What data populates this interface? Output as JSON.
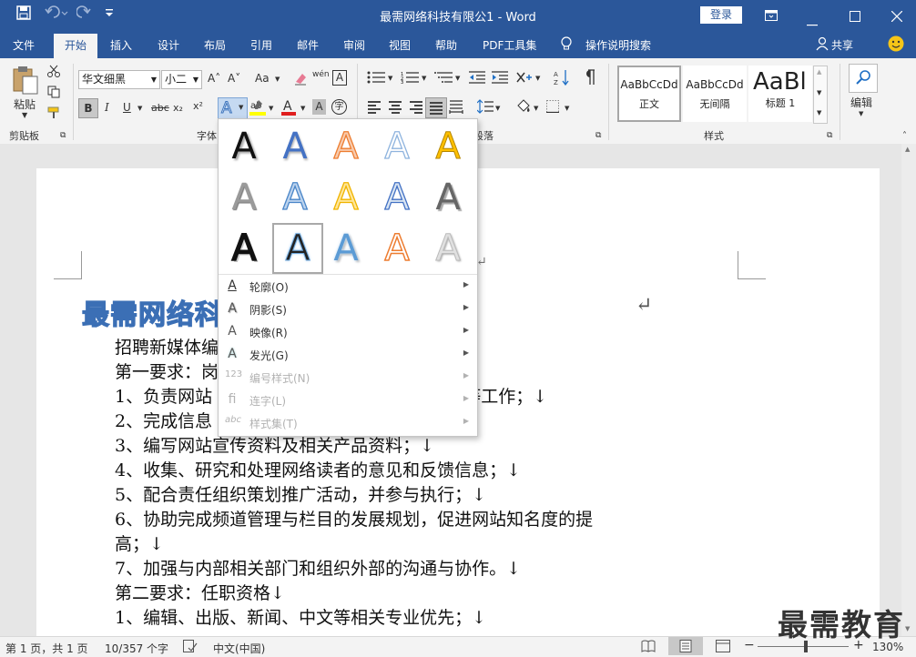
{
  "window": {
    "title": "最需网络科技有限公1 - Word",
    "login": "登录",
    "qat": {
      "save": "save-icon",
      "undo": "undo-icon",
      "redo": "redo-icon",
      "customize": "customize-icon"
    },
    "controls": {
      "ribbon_display": "ribbon-display-icon",
      "minimize": "minimize-icon",
      "maximize": "maximize-icon",
      "close": "close-icon"
    }
  },
  "menu": {
    "tabs": [
      "文件",
      "开始",
      "插入",
      "设计",
      "布局",
      "引用",
      "邮件",
      "审阅",
      "视图",
      "帮助",
      "PDF工具集"
    ],
    "active": "开始",
    "tell_me": "操作说明搜索",
    "share": "共享"
  },
  "ribbon": {
    "clipboard": {
      "paste": "粘贴",
      "label": "剪贴板"
    },
    "font": {
      "name": "华文细黑",
      "size": "小二",
      "label": "字体",
      "bold": "B",
      "italic": "I",
      "underline": "U",
      "strike": "abc",
      "sub": "x₂",
      "sup": "x²",
      "grow": "A˄",
      "shrink": "A˅",
      "case": "Aa",
      "pinyin": "wén",
      "char_border": "A",
      "char_shading": "A",
      "enclose": "字"
    },
    "paragraph": {
      "label": "段落"
    },
    "styles": {
      "label": "样式",
      "items": [
        {
          "preview": "AaBbCcDd",
          "name": "正文"
        },
        {
          "preview": "AaBbCcDd",
          "name": "无间隔"
        },
        {
          "preview": "AaBl",
          "name": "标题 1"
        }
      ]
    },
    "editing": {
      "label": "编辑"
    }
  },
  "document": {
    "heading": "最需网络科",
    "lines": [
      "招聘新媒体编",
      "第一要求：岗",
      "1、负责网站                              编辑、审校等工作；↓",
      "2、完成信息                            户；↓",
      "3、编写网站宣传资料及相关产品资料；↓",
      "4、收集、研究和处理网络读者的意见和反馈信息；↓",
      "5、配合责任组织策划推广活动，并参与执行；↓",
      "6、协助完成频道管理与栏目的发展规划，促进网站知名度的提",
      "高；↓",
      "7、加强与内部相关部门和组织外部的沟通与协作。↓",
      "第二要求：任职资格↓",
      "1、编辑、出版、新闻、中文等相关专业优先；↓"
    ],
    "return_mark": "↵"
  },
  "text_effects": {
    "glyph": "A",
    "menu": [
      {
        "label": "轮廓(O)",
        "icon": "outline-icon",
        "enabled": true
      },
      {
        "label": "阴影(S)",
        "icon": "shadow-icon",
        "enabled": true
      },
      {
        "label": "映像(R)",
        "icon": "reflection-icon",
        "enabled": true
      },
      {
        "label": "发光(G)",
        "icon": "glow-icon",
        "enabled": true
      },
      {
        "label": "编号样式(N)",
        "icon": "number-style-icon",
        "enabled": false
      },
      {
        "label": "连字(L)",
        "icon": "ligature-icon",
        "enabled": false
      },
      {
        "label": "样式集(T)",
        "icon": "stylistic-set-icon",
        "enabled": false
      }
    ]
  },
  "status": {
    "page": "第 1 页，共 1 页",
    "words": "10/357 个字",
    "language": "中文(中国)",
    "zoom": "130%",
    "zoom_minus": "−",
    "zoom_plus": "+"
  },
  "watermark": "最需教育",
  "colors": {
    "accent": "#2b579a",
    "ribbon": "#f3f3f3"
  }
}
